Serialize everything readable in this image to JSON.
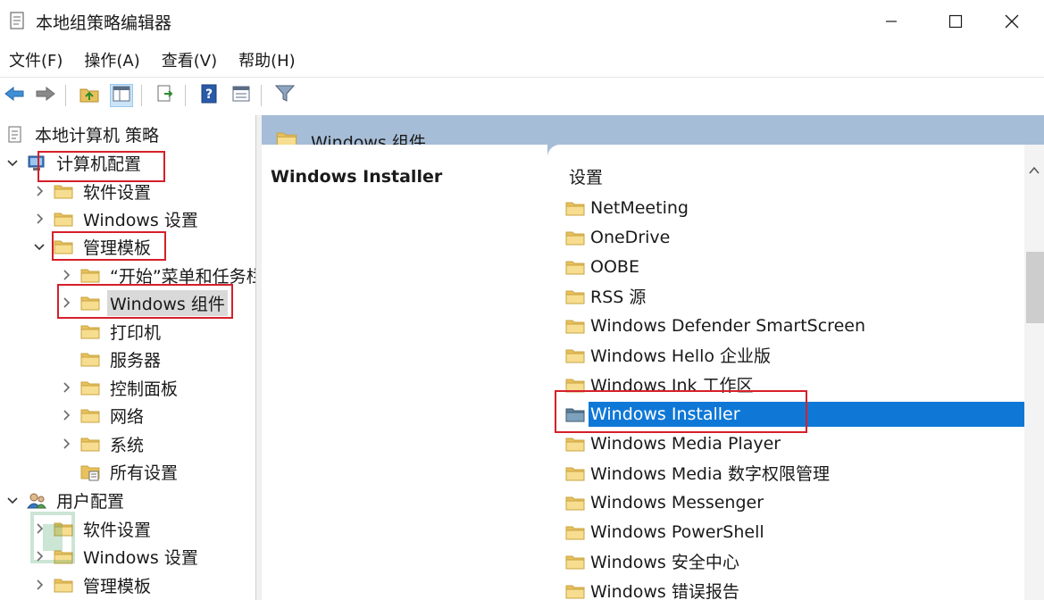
{
  "window": {
    "title": "本地组策略编辑器",
    "minimize_icon": "minimize-icon",
    "maximize_icon": "maximize-icon",
    "close_icon": "close-icon"
  },
  "menu": [
    "文件(F)",
    "操作(A)",
    "查看(V)",
    "帮助(H)"
  ],
  "toolbar": {
    "buttons": [
      "back-arrow-icon",
      "forward-arrow-icon",
      "up-folder-icon",
      "show-hide-tree-icon",
      "export-list-icon",
      "help-icon",
      "properties-icon",
      "filter-icon"
    ]
  },
  "tree": {
    "root": "本地计算机 策略",
    "computer_config": "计算机配置",
    "software_settings": "软件设置",
    "windows_settings": "Windows 设置",
    "admin_templates": "管理模板",
    "start_menu": "“开始”菜单和任务栏",
    "windows_components": "Windows 组件",
    "printers": "打印机",
    "servers": "服务器",
    "control_panel": "控制面板",
    "network": "网络",
    "system": "系统",
    "all_settings": "所有设置",
    "user_config": "用户配置",
    "user_software_settings": "软件设置",
    "user_windows_settings": "Windows 设置",
    "user_admin_templates": "管理模板"
  },
  "header": {
    "title": "Windows 组件"
  },
  "description": {
    "title": "Windows Installer"
  },
  "list": {
    "column": "设置",
    "items": [
      "NetMeeting",
      "OneDrive",
      "OOBE",
      "RSS 源",
      "Windows Defender SmartScreen",
      "Windows Hello 企业版",
      "Windows Ink 工作区",
      "Windows Installer",
      "Windows Media Player",
      "Windows Media 数字权限管理",
      "Windows Messenger",
      "Windows PowerShell",
      "Windows 安全中心",
      "Windows 错误报告"
    ],
    "selected": "Windows Installer"
  },
  "colors": {
    "header_bg": "#a6bdd7",
    "selection": "#0f78d7",
    "highlight_box": "#d61f2a",
    "folder_yellow": "#f4d27a"
  }
}
